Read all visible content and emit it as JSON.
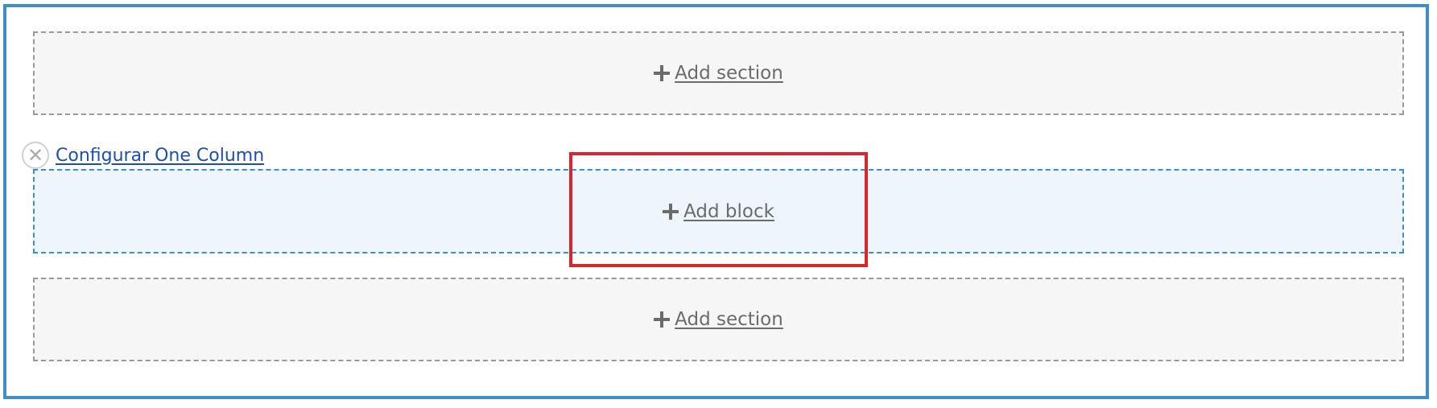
{
  "layout_builder": {
    "add_section_top": {
      "label": "Add section",
      "icon": "plus-icon"
    },
    "section": {
      "remove_icon": "close-icon",
      "remove_glyph": "✕",
      "configure_label": "Configurar One Column",
      "add_block": {
        "label": "Add block",
        "icon": "plus-icon"
      }
    },
    "add_section_bottom": {
      "label": "Add section",
      "icon": "plus-icon"
    }
  },
  "colors": {
    "frame_border": "#3a8fcc",
    "section_zone_bg": "#f6f6f6",
    "block_zone_bg": "#eef5fc",
    "highlight": "#d9262e",
    "link": "#1b4fb1"
  }
}
